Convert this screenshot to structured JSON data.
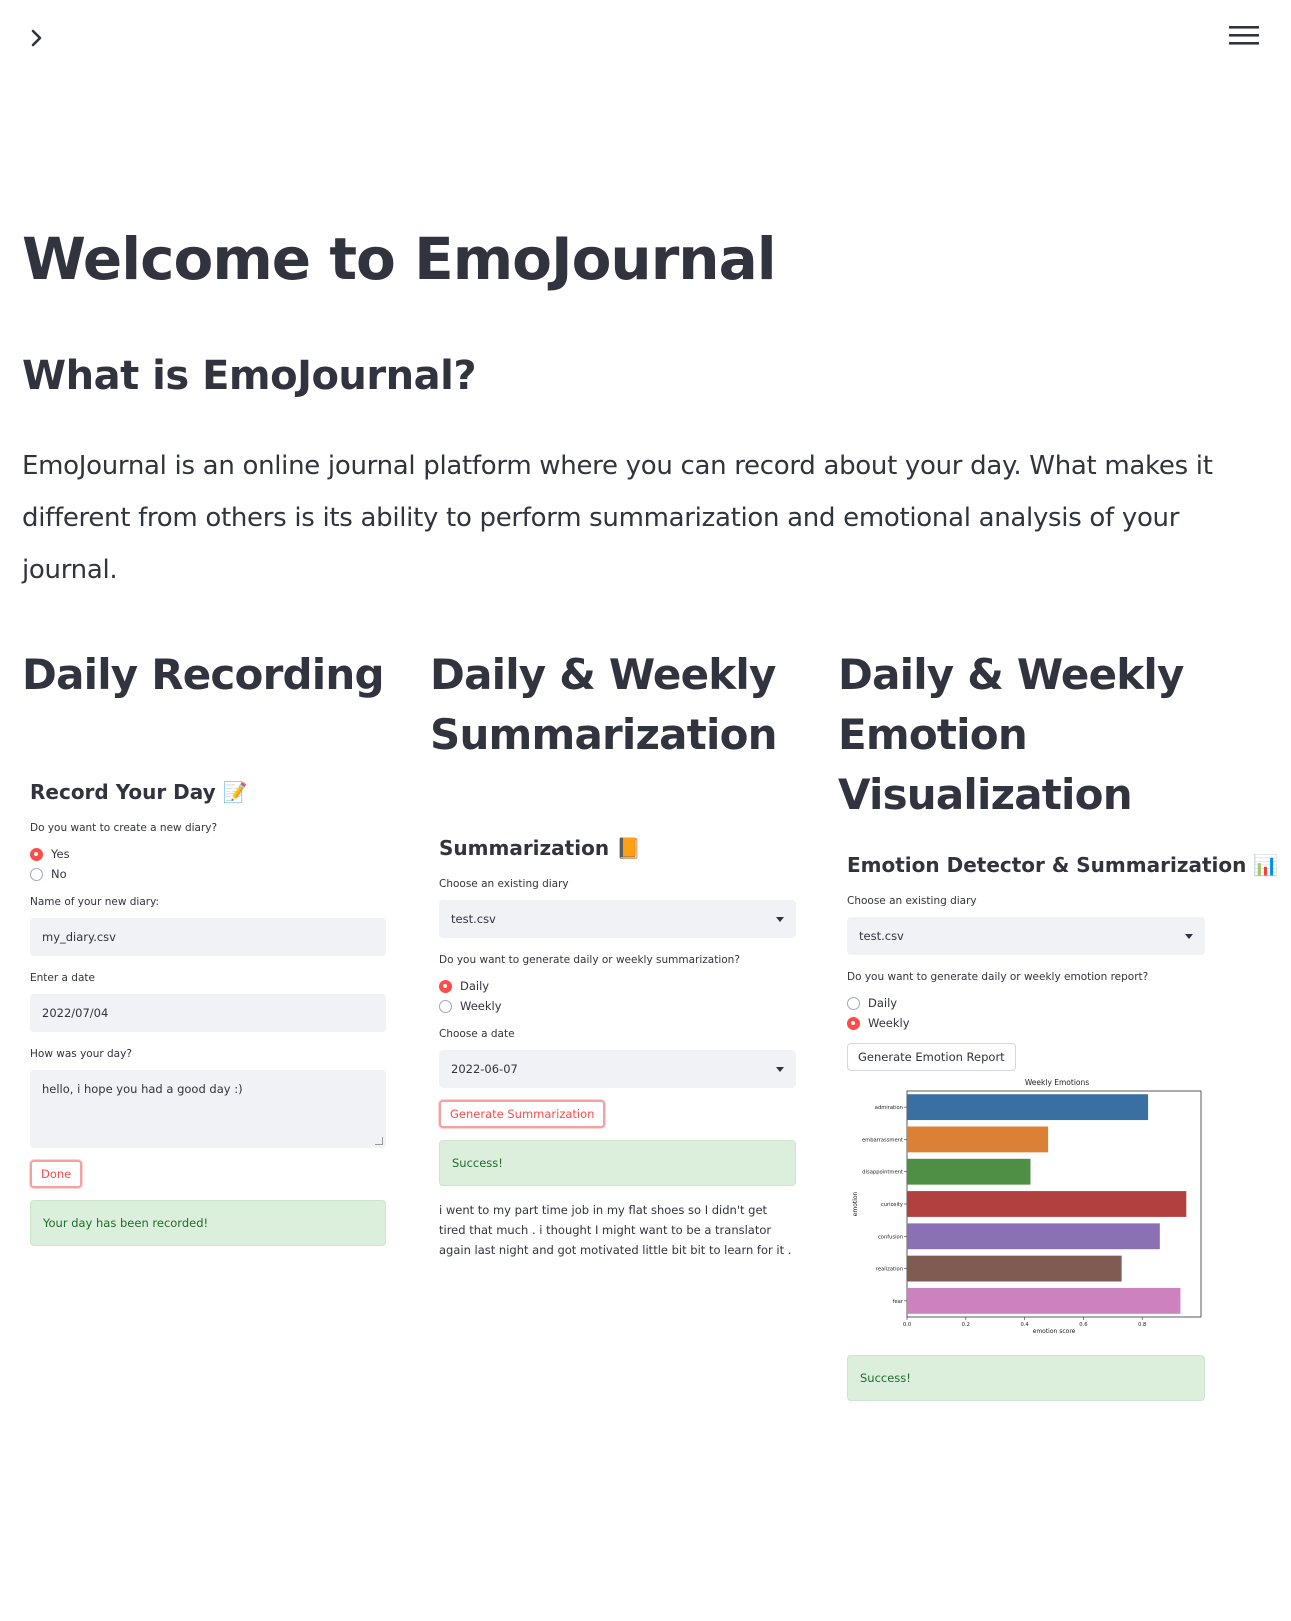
{
  "topbar": {
    "toggle_icon": "chevron-right-icon",
    "menu_icon": "hamburger-menu-icon"
  },
  "page": {
    "title": "Welcome to EmoJournal",
    "subtitle": "What is EmoJournal?",
    "intro": "EmoJournal is an online journal platform where you can record about your day. What makes it different from others is its ability to perform summarization and emotional analysis of your journal."
  },
  "columns": [
    {
      "heading": "Daily Recording"
    },
    {
      "heading": "Daily & Weekly Summarization"
    },
    {
      "heading": "Daily & Weekly Emotion Visualization"
    }
  ],
  "record": {
    "title": "Record Your Day 📝",
    "q_new": "Do you want to create a new diary?",
    "options": [
      "Yes",
      "No"
    ],
    "selected": "Yes",
    "name_label": "Name of your new diary:",
    "name_value": "my_diary.csv",
    "date_label": "Enter a date",
    "date_value": "2022/07/04",
    "day_label": "How was your day?",
    "day_value": "hello, i hope you had a good day :)",
    "done_label": "Done",
    "success": "Your day has been recorded!"
  },
  "summ": {
    "title": "Summarization 📙",
    "diary_label": "Choose an existing diary",
    "diary_value": "test.csv",
    "q_type": "Do you want to generate daily or weekly summarization?",
    "options": [
      "Daily",
      "Weekly"
    ],
    "selected": "Daily",
    "date_label": "Choose a date",
    "date_value": "2022-06-07",
    "button": "Generate Summarization",
    "success": "Success!",
    "summary": "i went to my part time job in my flat shoes so I didn't get tired that much . i thought I might want to be a translator again last night and got motivated little bit bit to learn for it ."
  },
  "emo": {
    "title": "Emotion Detector & Summarization 📊",
    "diary_label": "Choose an existing diary",
    "diary_value": "test.csv",
    "q_type": "Do you want to generate daily or weekly emotion report?",
    "options": [
      "Daily",
      "Weekly"
    ],
    "selected": "Weekly",
    "button": "Generate Emotion Report",
    "success": "Success!"
  },
  "chart_data": {
    "type": "bar",
    "orientation": "horizontal",
    "title": "Weekly Emotions",
    "xlabel": "emotion score",
    "ylabel": "emotion",
    "categories": [
      "admiration",
      "embarrassment",
      "disappointment",
      "curiosity",
      "confusion",
      "realization",
      "fear"
    ],
    "values": [
      0.82,
      0.48,
      0.42,
      0.95,
      0.86,
      0.73,
      0.93
    ],
    "xlim": [
      0,
      1.0
    ],
    "xticks": [
      "0.0",
      "0.2",
      "0.4",
      "0.6",
      "0.8"
    ],
    "colors": [
      "#3a6fa3",
      "#dc8035",
      "#4e8e45",
      "#b2403f",
      "#8a71b3",
      "#805b51",
      "#cc82be"
    ]
  }
}
